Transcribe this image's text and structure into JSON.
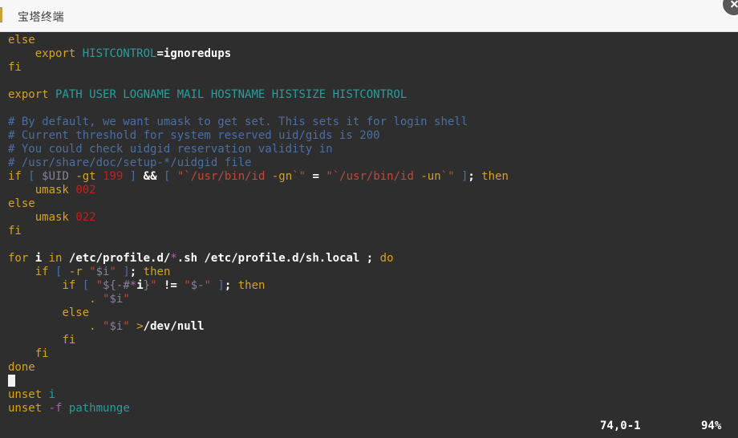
{
  "window": {
    "title": "宝塔终端",
    "close_label": "×",
    "close_icon": "close-icon"
  },
  "terminal": {
    "background_color": "#2e2e2e",
    "foreground_color": "#d0d0d0",
    "lines": [
      [
        {
          "t": "else",
          "c": "kw"
        }
      ],
      [
        {
          "t": "    ",
          "c": "pl"
        },
        {
          "t": "export",
          "c": "kw"
        },
        {
          "t": " ",
          "c": "pl"
        },
        {
          "t": "HISTCONTROL",
          "c": "var"
        },
        {
          "t": "=",
          "c": "op"
        },
        {
          "t": "ignoredups",
          "c": "id"
        }
      ],
      [
        {
          "t": "fi",
          "c": "kw"
        }
      ],
      [],
      [
        {
          "t": "export",
          "c": "kw"
        },
        {
          "t": " ",
          "c": "pl"
        },
        {
          "t": "PATH USER LOGNAME MAIL HOSTNAME HISTSIZE HISTCONTROL",
          "c": "var"
        }
      ],
      [],
      [
        {
          "t": "# By default, we want umask to get set. This sets it for login shell",
          "c": "cm"
        }
      ],
      [
        {
          "t": "# Current threshold for system reserved uid/gids is 200",
          "c": "cm"
        }
      ],
      [
        {
          "t": "# You could check uidgid reservation validity in",
          "c": "cm"
        }
      ],
      [
        {
          "t": "# /usr/share/doc/setup-*/uidgid file",
          "c": "cm"
        }
      ],
      [
        {
          "t": "if",
          "c": "kw"
        },
        {
          "t": " ",
          "c": "pl"
        },
        {
          "t": "[",
          "c": "brk"
        },
        {
          "t": " ",
          "c": "pl"
        },
        {
          "t": "$UID",
          "c": "dim"
        },
        {
          "t": " ",
          "c": "pl"
        },
        {
          "t": "-gt",
          "c": "kw"
        },
        {
          "t": " ",
          "c": "pl"
        },
        {
          "t": "199",
          "c": "num"
        },
        {
          "t": " ",
          "c": "pl"
        },
        {
          "t": "]",
          "c": "brk"
        },
        {
          "t": " ",
          "c": "pl"
        },
        {
          "t": "&&",
          "c": "op"
        },
        {
          "t": " ",
          "c": "pl"
        },
        {
          "t": "[",
          "c": "brk"
        },
        {
          "t": " ",
          "c": "pl"
        },
        {
          "t": "\"`/usr/bin/id ",
          "c": "str"
        },
        {
          "t": "-gn",
          "c": "kw"
        },
        {
          "t": "`\"",
          "c": "str"
        },
        {
          "t": " ",
          "c": "pl"
        },
        {
          "t": "=",
          "c": "op"
        },
        {
          "t": " ",
          "c": "pl"
        },
        {
          "t": "\"`/usr/bin/id ",
          "c": "str"
        },
        {
          "t": "-un",
          "c": "kw"
        },
        {
          "t": "`\"",
          "c": "str"
        },
        {
          "t": " ",
          "c": "pl"
        },
        {
          "t": "]",
          "c": "brk"
        },
        {
          "t": ";",
          "c": "op"
        },
        {
          "t": " ",
          "c": "pl"
        },
        {
          "t": "then",
          "c": "kw"
        }
      ],
      [
        {
          "t": "    ",
          "c": "pl"
        },
        {
          "t": "umask",
          "c": "kw"
        },
        {
          "t": " ",
          "c": "pl"
        },
        {
          "t": "002",
          "c": "num"
        }
      ],
      [
        {
          "t": "else",
          "c": "kw"
        }
      ],
      [
        {
          "t": "    ",
          "c": "pl"
        },
        {
          "t": "umask",
          "c": "kw"
        },
        {
          "t": " ",
          "c": "pl"
        },
        {
          "t": "022",
          "c": "num"
        }
      ],
      [
        {
          "t": "fi",
          "c": "kw"
        }
      ],
      [],
      [
        {
          "t": "for",
          "c": "kw"
        },
        {
          "t": " ",
          "c": "pl"
        },
        {
          "t": "i",
          "c": "id"
        },
        {
          "t": " ",
          "c": "pl"
        },
        {
          "t": "in",
          "c": "kw"
        },
        {
          "t": " ",
          "c": "pl"
        },
        {
          "t": "/etc/profile.d/",
          "c": "id"
        },
        {
          "t": "*",
          "c": "mag"
        },
        {
          "t": ".sh /etc/profile.d/sh.local",
          "c": "id"
        },
        {
          "t": " ",
          "c": "pl"
        },
        {
          "t": ";",
          "c": "op"
        },
        {
          "t": " ",
          "c": "pl"
        },
        {
          "t": "do",
          "c": "kw"
        }
      ],
      [
        {
          "t": "    ",
          "c": "pl"
        },
        {
          "t": "if",
          "c": "kw"
        },
        {
          "t": " ",
          "c": "pl"
        },
        {
          "t": "[",
          "c": "brk"
        },
        {
          "t": " ",
          "c": "pl"
        },
        {
          "t": "-r",
          "c": "kw"
        },
        {
          "t": " ",
          "c": "pl"
        },
        {
          "t": "\"",
          "c": "str"
        },
        {
          "t": "$i",
          "c": "dim"
        },
        {
          "t": "\"",
          "c": "str"
        },
        {
          "t": " ",
          "c": "pl"
        },
        {
          "t": "]",
          "c": "brk"
        },
        {
          "t": ";",
          "c": "op"
        },
        {
          "t": " ",
          "c": "pl"
        },
        {
          "t": "then",
          "c": "kw"
        }
      ],
      [
        {
          "t": "        ",
          "c": "pl"
        },
        {
          "t": "if",
          "c": "kw"
        },
        {
          "t": " ",
          "c": "pl"
        },
        {
          "t": "[",
          "c": "brk"
        },
        {
          "t": " ",
          "c": "pl"
        },
        {
          "t": "\"",
          "c": "str"
        },
        {
          "t": "${-#",
          "c": "dim"
        },
        {
          "t": "*",
          "c": "mag"
        },
        {
          "t": "i",
          "c": "id"
        },
        {
          "t": "}",
          "c": "dim"
        },
        {
          "t": "\"",
          "c": "str"
        },
        {
          "t": " ",
          "c": "pl"
        },
        {
          "t": "!=",
          "c": "op"
        },
        {
          "t": " ",
          "c": "pl"
        },
        {
          "t": "\"",
          "c": "str"
        },
        {
          "t": "$-",
          "c": "dim"
        },
        {
          "t": "\"",
          "c": "str"
        },
        {
          "t": " ",
          "c": "pl"
        },
        {
          "t": "]",
          "c": "brk"
        },
        {
          "t": ";",
          "c": "op"
        },
        {
          "t": " ",
          "c": "pl"
        },
        {
          "t": "then",
          "c": "kw"
        }
      ],
      [
        {
          "t": "            ",
          "c": "pl"
        },
        {
          "t": ".",
          "c": "kw"
        },
        {
          "t": " ",
          "c": "pl"
        },
        {
          "t": "\"",
          "c": "str"
        },
        {
          "t": "$i",
          "c": "dim"
        },
        {
          "t": "\"",
          "c": "str"
        }
      ],
      [
        {
          "t": "        ",
          "c": "pl"
        },
        {
          "t": "else",
          "c": "kw"
        }
      ],
      [
        {
          "t": "            ",
          "c": "pl"
        },
        {
          "t": ".",
          "c": "kw"
        },
        {
          "t": " ",
          "c": "pl"
        },
        {
          "t": "\"",
          "c": "str"
        },
        {
          "t": "$i",
          "c": "dim"
        },
        {
          "t": "\"",
          "c": "str"
        },
        {
          "t": " ",
          "c": "pl"
        },
        {
          "t": ">",
          "c": "kw"
        },
        {
          "t": "/dev/null",
          "c": "id"
        }
      ],
      [
        {
          "t": "        ",
          "c": "pl"
        },
        {
          "t": "fi",
          "c": "kw"
        }
      ],
      [
        {
          "t": "    ",
          "c": "pl"
        },
        {
          "t": "fi",
          "c": "kw"
        }
      ],
      [
        {
          "t": "done",
          "c": "kw"
        }
      ],
      [
        {
          "t": "",
          "c": "pl",
          "cursor": true
        }
      ],
      [
        {
          "t": "unset",
          "c": "kw"
        },
        {
          "t": " ",
          "c": "pl"
        },
        {
          "t": "i",
          "c": "var"
        }
      ],
      [
        {
          "t": "unset",
          "c": "kw"
        },
        {
          "t": " ",
          "c": "pl"
        },
        {
          "t": "-f",
          "c": "mag"
        },
        {
          "t": " ",
          "c": "pl"
        },
        {
          "t": "pathmunge",
          "c": "var"
        }
      ]
    ]
  },
  "statusline": {
    "position": "74,0-1",
    "percent": "94%"
  }
}
